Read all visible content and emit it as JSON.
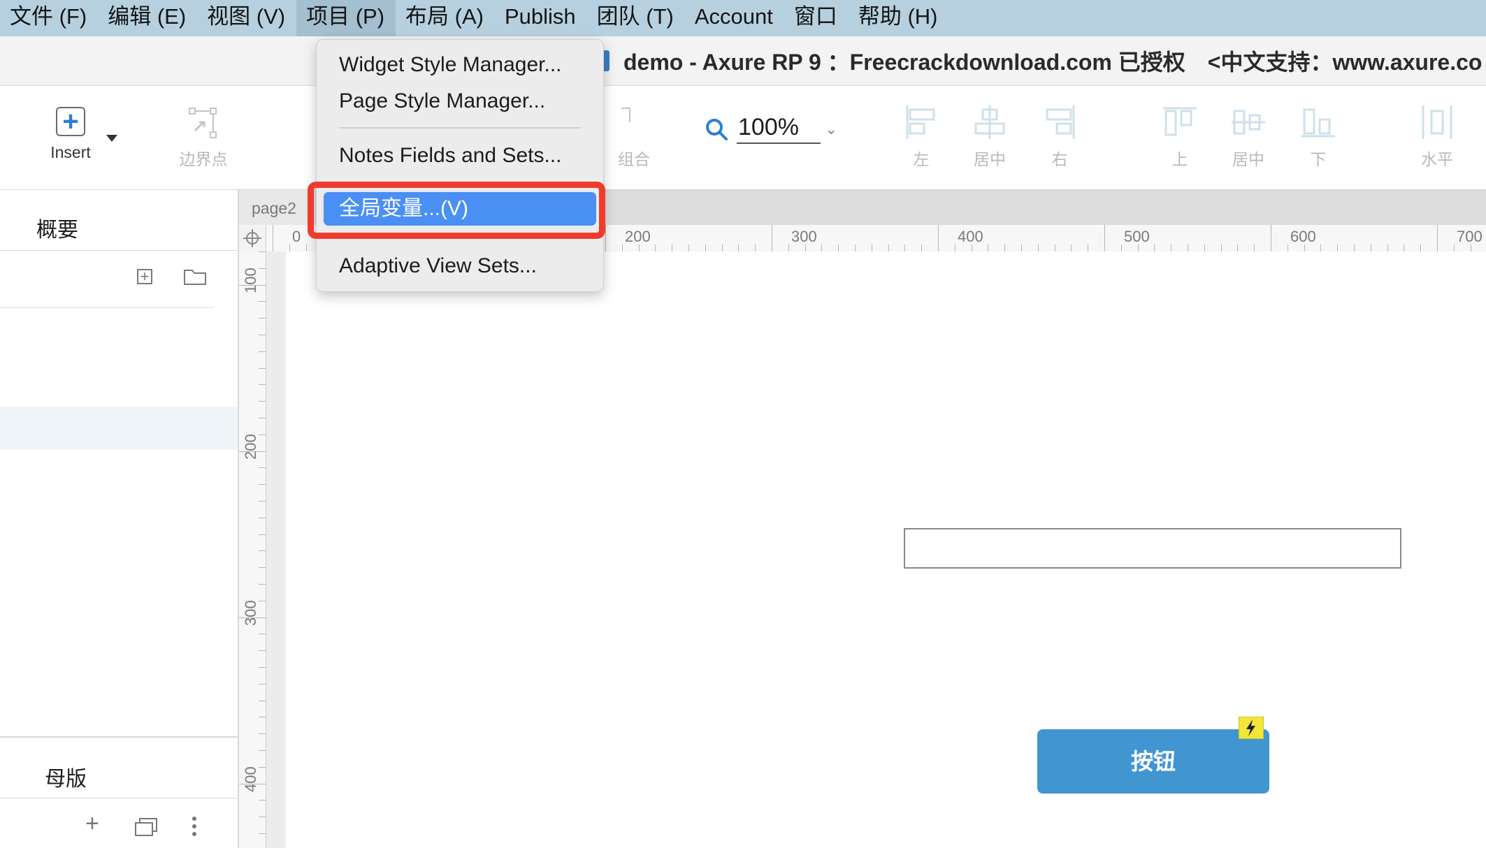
{
  "menubar": {
    "items": [
      "文件 (F)",
      "编辑 (E)",
      "视图 (V)",
      "项目 (P)",
      "布局 (A)",
      "Publish",
      "团队 (T)",
      "Account",
      "窗口",
      "帮助 (H)"
    ],
    "active_index": 3
  },
  "title": "demo - Axure RP 9 ：Freecrackdownload.com 已授权　<中文支持：www.axure.co",
  "toolbar": {
    "insert_label": "Insert",
    "boundary_label": "边界点",
    "group_label": "组合",
    "zoom_value": "100%",
    "align_left": "左",
    "align_center": "居中",
    "align_right": "右",
    "align_top": "上",
    "align_middle": "居中",
    "align_bottom": "下",
    "distribute_horizontal": "水平"
  },
  "left_panel": {
    "outline_title": "概要",
    "masters_title": "母版"
  },
  "canvas": {
    "page_tab": "page2",
    "hruler_labels": [
      "0",
      "200",
      "300",
      "400",
      "500",
      "600",
      "700"
    ],
    "vruler_labels": [
      "100",
      "200",
      "300",
      "400"
    ],
    "button_label": "按钮"
  },
  "dropdown": {
    "items": [
      "Widget Style Manager...",
      "Page Style Manager...",
      "Notes Fields and Sets...",
      "全局变量...(V)",
      "Adaptive View Sets..."
    ],
    "highlighted_index": 3
  },
  "colors": {
    "menubar_bg": "#b7d0df",
    "highlight": "#4a8ff3",
    "callout": "#ee3b2e",
    "button_bg": "#4196d2",
    "accent_blue": "#2c7fd0"
  }
}
